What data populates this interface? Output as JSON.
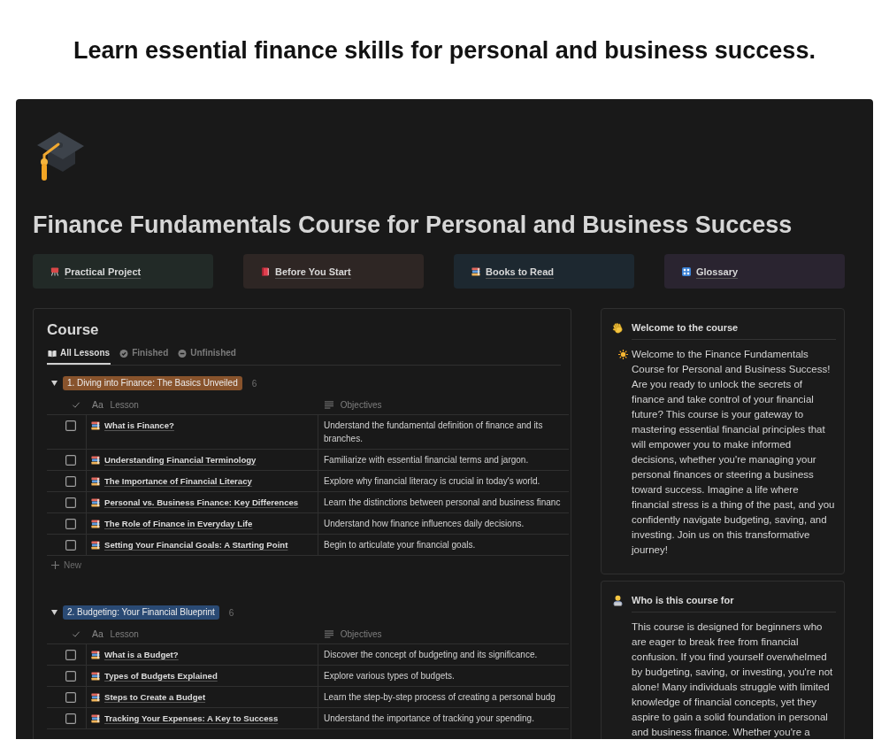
{
  "heading": "Learn essential finance skills for personal and business success.",
  "page": {
    "title": "Finance Fundamentals Course for Personal and Business Success",
    "links": [
      {
        "label": "Practical Project",
        "kind": "project",
        "color": "#222a27"
      },
      {
        "label": "Before You Start",
        "kind": "book",
        "color": "#2e2624"
      },
      {
        "label": "Books to Read",
        "kind": "books",
        "color": "#1d2830"
      },
      {
        "label": "Glossary",
        "kind": "glossary",
        "color": "#2a2430"
      }
    ]
  },
  "course": {
    "title": "Course",
    "tabs": [
      {
        "label": "All Lessons",
        "kind": "book",
        "selected": true
      },
      {
        "label": "Finished",
        "kind": "check",
        "selected": false
      },
      {
        "label": "Unfinished",
        "kind": "minus",
        "selected": false
      }
    ],
    "groups": [
      {
        "label": "1. Diving into Finance: The Basics Unveiled",
        "color": "#88532c",
        "count": "6",
        "expanded": true,
        "columns": [
          {
            "kind": "checkbox"
          },
          {
            "kind": "title",
            "icon_text": "Aa",
            "label": "Lesson"
          },
          {
            "kind": "text",
            "label": "Objectives"
          }
        ],
        "rows": [
          {
            "checked": false,
            "lesson": "What is Finance?",
            "objective": "Understand the fundamental definition of finance and its branches."
          },
          {
            "checked": false,
            "lesson": "Understanding Financial Terminology",
            "objective": "Familiarize with essential financial terms and jargon."
          },
          {
            "checked": false,
            "lesson": "The Importance of Financial Literacy",
            "objective": "Explore why financial literacy is crucial in today's world."
          },
          {
            "checked": false,
            "lesson": "Personal vs. Business Finance: Key Differences",
            "objective": "Learn the distinctions between personal and business financ"
          },
          {
            "checked": false,
            "lesson": "The Role of Finance in Everyday Life",
            "objective": "Understand how finance influences daily decisions."
          },
          {
            "checked": false,
            "lesson": "Setting Your Financial Goals: A Starting Point",
            "objective": "Begin to articulate your financial goals."
          }
        ],
        "new_label": "New"
      },
      {
        "label": "2. Budgeting: Your Financial Blueprint",
        "color": "#2a4a74",
        "count": "6",
        "expanded": true,
        "columns": [
          {
            "kind": "checkbox"
          },
          {
            "kind": "title",
            "icon_text": "Aa",
            "label": "Lesson"
          },
          {
            "kind": "text",
            "label": "Objectives"
          }
        ],
        "rows": [
          {
            "checked": false,
            "lesson": "What is a Budget?",
            "objective": "Discover the concept of budgeting and its significance."
          },
          {
            "checked": false,
            "lesson": "Types of Budgets Explained",
            "objective": "Explore various types of budgets."
          },
          {
            "checked": false,
            "lesson": "Steps to Create a Budget",
            "objective": "Learn the step-by-step process of creating a personal budg"
          },
          {
            "checked": false,
            "lesson": "Tracking Your Expenses: A Key to Success",
            "objective": "Understand the importance of tracking your spending."
          }
        ]
      }
    ]
  },
  "callouts": [
    {
      "kind": "welcome",
      "title": "Welcome to the course",
      "body_icon": {
        "kind": "sun"
      },
      "body": "Welcome to the Finance Fundamentals Course for Personal and Business Success! Are you ready to unlock the secrets of finance and take control of your financial future? This course is your gateway to mastering essential financial principles that will empower you to make informed decisions, whether you're managing your personal finances or steering a business toward success. Imagine a life where financial stress is a thing of the past, and you confidently navigate budgeting, saving, and investing. Join us on this transformative journey!"
    },
    {
      "kind": "audience",
      "title": "Who is this course for",
      "body": "This course is designed for beginners who are eager to break free from financial confusion. If you find yourself overwhelmed by budgeting, saving, or investing, you're not alone! Many individuals struggle with limited knowledge of financial concepts, yet they aspire to gain a solid foundation in personal and business finance. Whether you're a"
    }
  ]
}
